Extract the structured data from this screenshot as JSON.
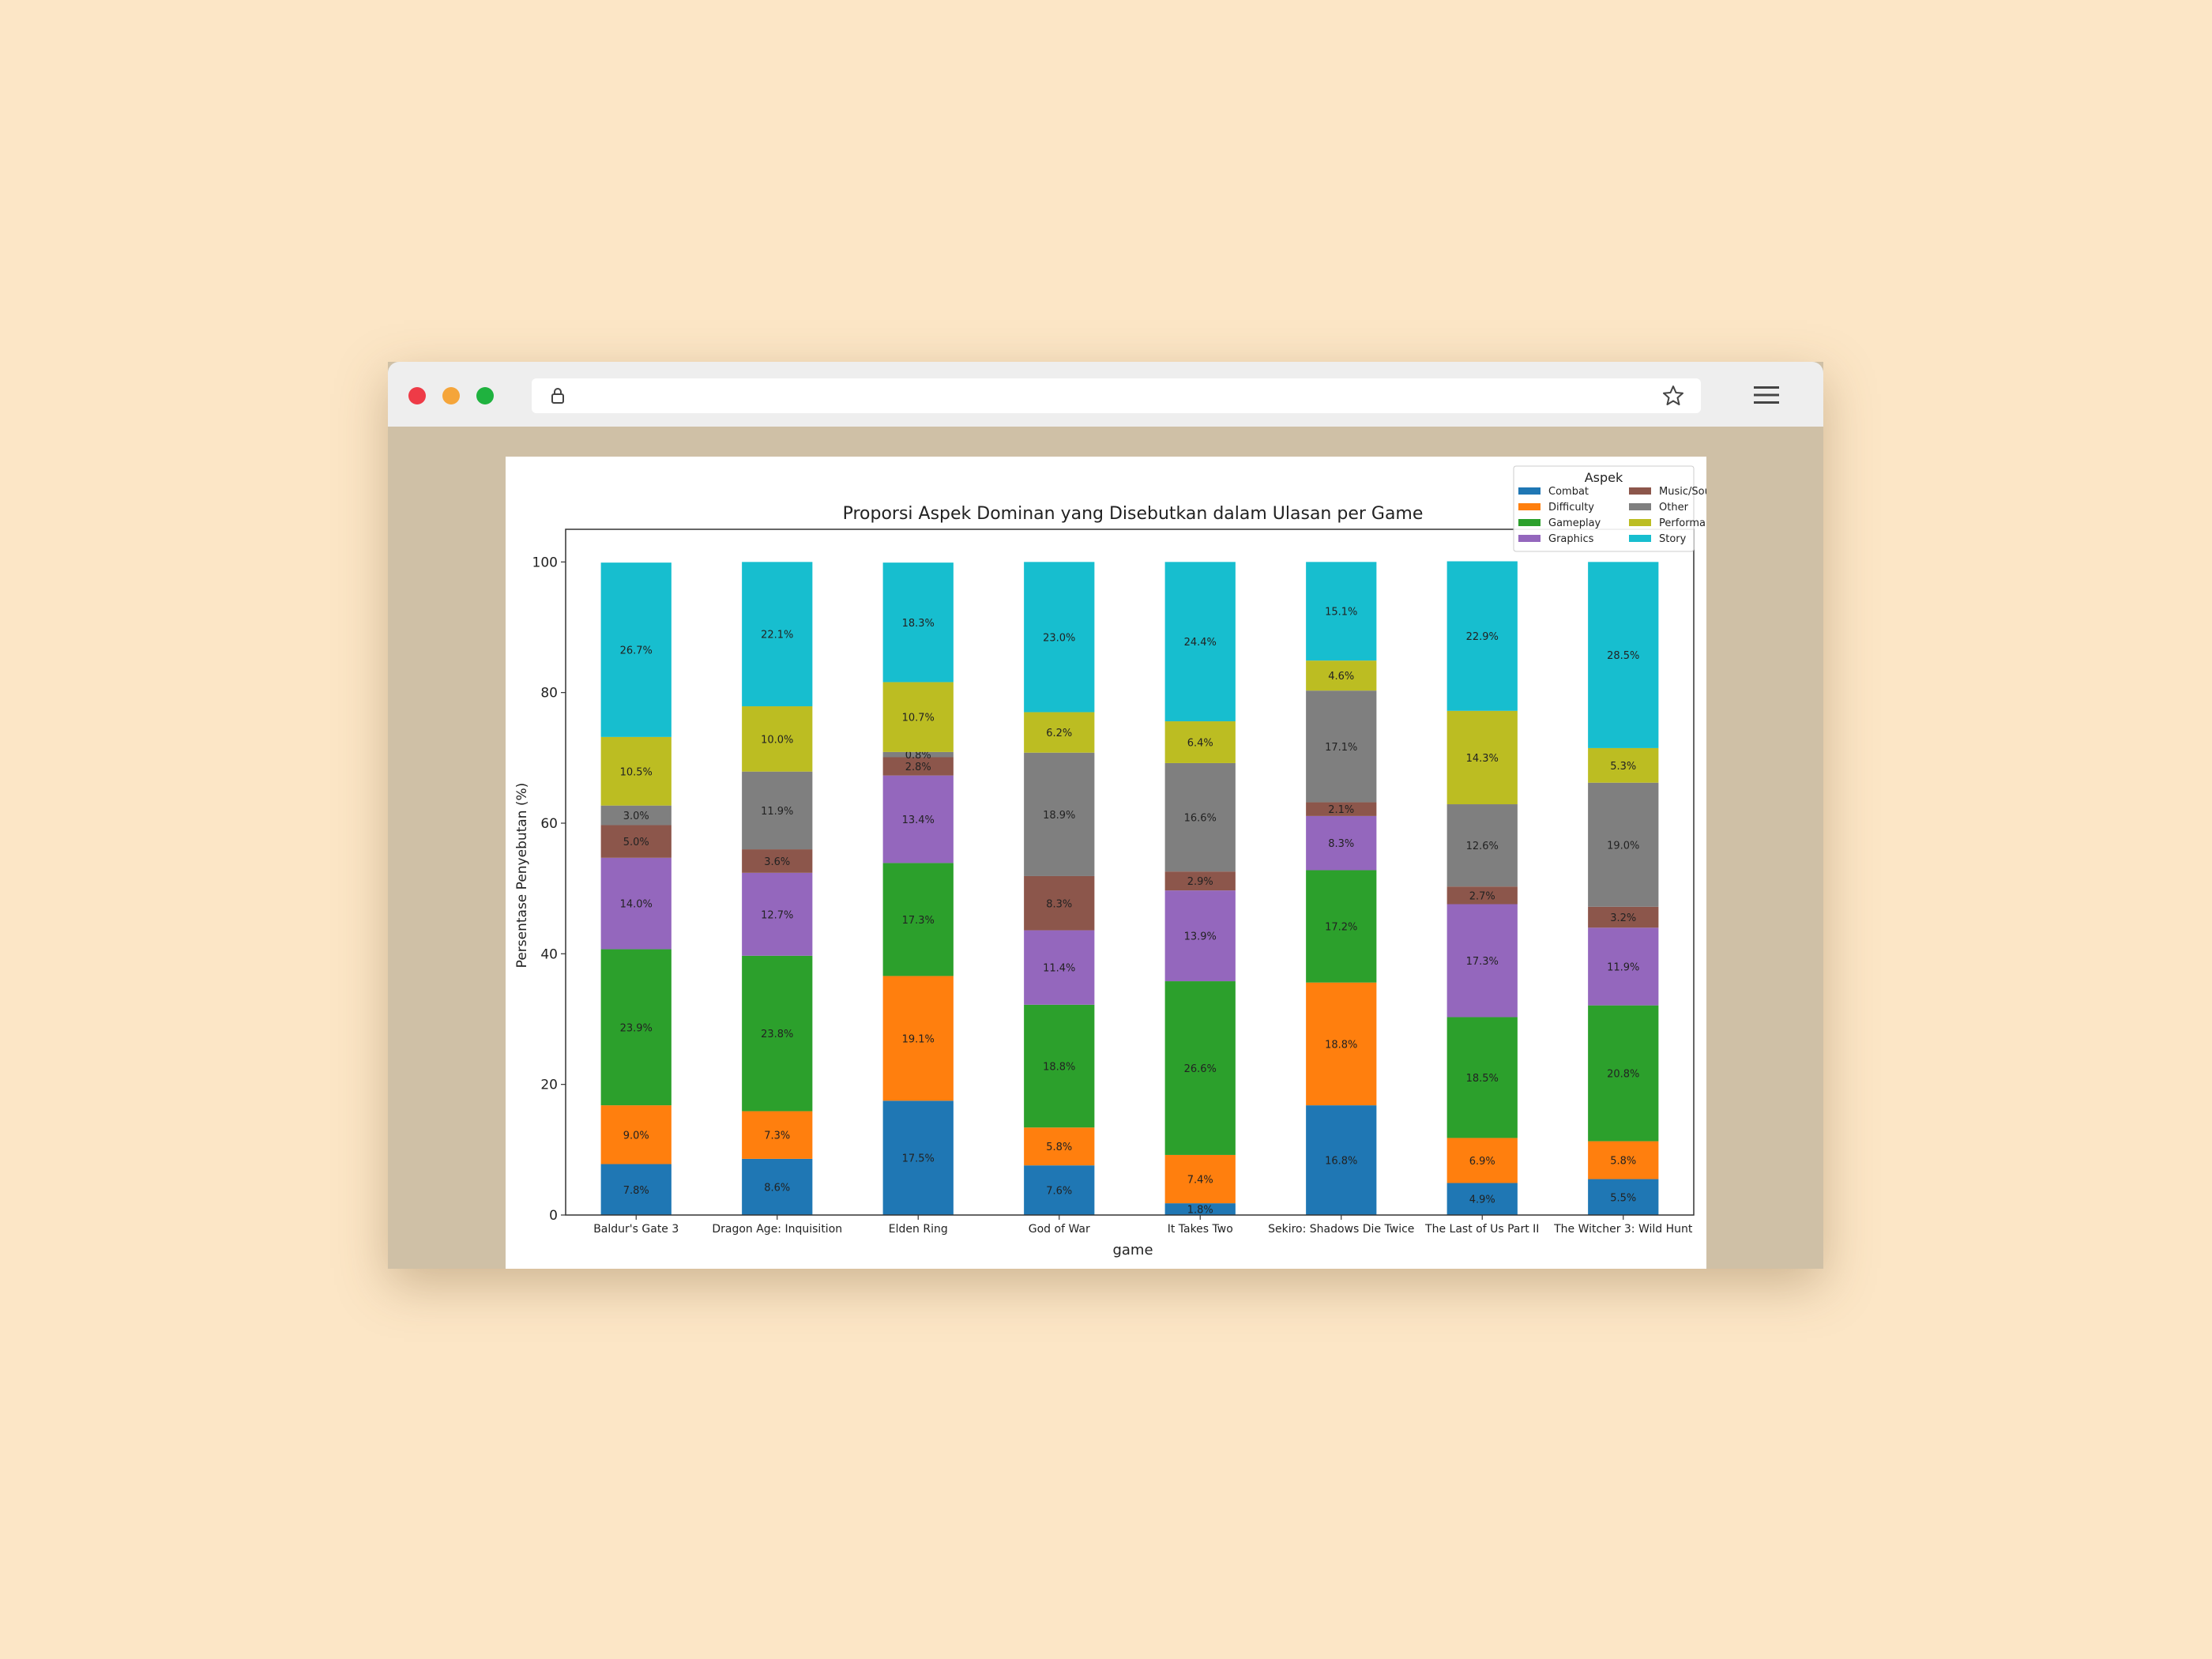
{
  "browser": {
    "lock_icon": "lock-icon",
    "star_icon": "star-icon",
    "menu_icon": "hamburger-menu-icon"
  },
  "colors": {
    "background": "#fce6c6",
    "Combat": "#1f77b4",
    "Difficulty": "#ff7f0e",
    "Gameplay": "#2ca02c",
    "Graphics": "#9467bd",
    "Music/Sound": "#8c564b",
    "Other": "#7f7f7f",
    "Performance": "#bcbd22",
    "Story": "#17becf"
  },
  "chart_data": {
    "type": "bar",
    "stacked": true,
    "title": "Proporsi Aspek Dominan yang Disebutkan dalam Ulasan per Game",
    "xlabel": "game",
    "ylabel": "Persentase Penyebutan (%)",
    "ylim": [
      0,
      105
    ],
    "yticks": [
      0,
      20,
      40,
      60,
      80,
      100
    ],
    "legend": {
      "title": "Aspek",
      "placement": "top-right",
      "columns": 2
    },
    "categories": [
      "Baldur's Gate 3",
      "Dragon Age: Inquisition",
      "Elden Ring",
      "God of War",
      "It Takes Two",
      "Sekiro: Shadows Die Twice",
      "The Last of Us Part II",
      "The Witcher 3: Wild Hunt"
    ],
    "series": [
      {
        "name": "Combat",
        "values": [
          7.8,
          8.6,
          17.5,
          7.6,
          1.8,
          16.8,
          4.9,
          5.5
        ]
      },
      {
        "name": "Difficulty",
        "values": [
          9.0,
          7.3,
          19.1,
          5.8,
          7.4,
          18.8,
          6.9,
          5.8
        ]
      },
      {
        "name": "Gameplay",
        "values": [
          23.9,
          23.8,
          17.3,
          18.8,
          26.6,
          17.2,
          18.5,
          20.8
        ]
      },
      {
        "name": "Graphics",
        "values": [
          14.0,
          12.7,
          13.4,
          11.4,
          13.9,
          8.3,
          17.3,
          11.9
        ]
      },
      {
        "name": "Music/Sound",
        "values": [
          5.0,
          3.6,
          2.8,
          8.3,
          2.9,
          2.1,
          2.7,
          3.2
        ]
      },
      {
        "name": "Other",
        "values": [
          3.0,
          11.9,
          0.8,
          18.9,
          16.6,
          17.1,
          12.6,
          19.0
        ]
      },
      {
        "name": "Performance",
        "values": [
          10.5,
          10.0,
          10.7,
          6.2,
          6.4,
          4.6,
          14.3,
          5.3
        ]
      },
      {
        "name": "Story",
        "values": [
          26.7,
          22.1,
          18.3,
          23.0,
          24.4,
          15.1,
          22.9,
          28.5
        ]
      }
    ]
  }
}
